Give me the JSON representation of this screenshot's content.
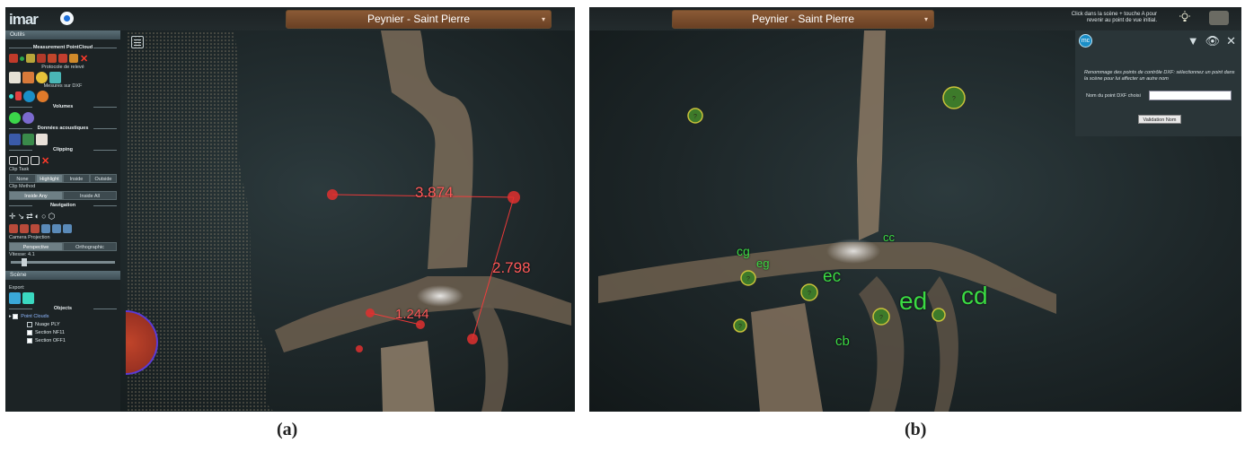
{
  "panel_a": {
    "title": "Peynier - Saint Pierre",
    "logo_text": "imar",
    "sidebar": {
      "header": "Outils",
      "measurement_section": "Measurement PointCloud",
      "protocol_label": "Protocole de relevé",
      "dxf_label": "Mesures sur DXF",
      "volumes_section": "Volumes",
      "acoustic_section": "Données acoustiques",
      "clipping_section": "Clipping",
      "clip_task_label": "Clip Task",
      "clip_task_options": [
        "None",
        "Highlight",
        "Inside",
        "Outside"
      ],
      "clip_task_selected": "Highlight",
      "clip_method_label": "Clip Method",
      "clip_method_options": [
        "Inside Any",
        "Inside All"
      ],
      "navigation_section": "Navigation",
      "camera_projection_label": "Camera Projection",
      "camera_projection_options": [
        "Perspective",
        "Orthographic"
      ],
      "vitesse_label": "Vitesse: 4.1",
      "vitesse_value": 0.1,
      "scene_header": "Scène",
      "export_label": "Export:",
      "objects_section": "Objects",
      "tree_root": "Point Clouds",
      "tree_items": [
        "Nuage PLY",
        "Section NF11",
        "Section OFF1"
      ]
    },
    "measurements": [
      "3.874",
      "2.798",
      "1.244"
    ],
    "accent_color": "#ff5a5a"
  },
  "panel_b": {
    "title": "Peynier - Saint Pierre",
    "hint": "Click dans la scène + touche A pour revenir au point de vue initial.",
    "infobox": {
      "mc_label": "mc",
      "text": "Renommage des points de contrôle DXF: sélectionnez un point dans la scène pour lui affecter un autre nom",
      "field_label": "Nom du point DXF choisi",
      "button_label": "Validation Nom"
    },
    "point_labels": [
      "cc",
      "cg",
      "eg",
      "ec",
      "ed",
      "cd",
      "cb"
    ],
    "marker_label": "?",
    "accent_color": "#3bdb43"
  },
  "captions": {
    "a": "(a)",
    "b": "(b)"
  }
}
